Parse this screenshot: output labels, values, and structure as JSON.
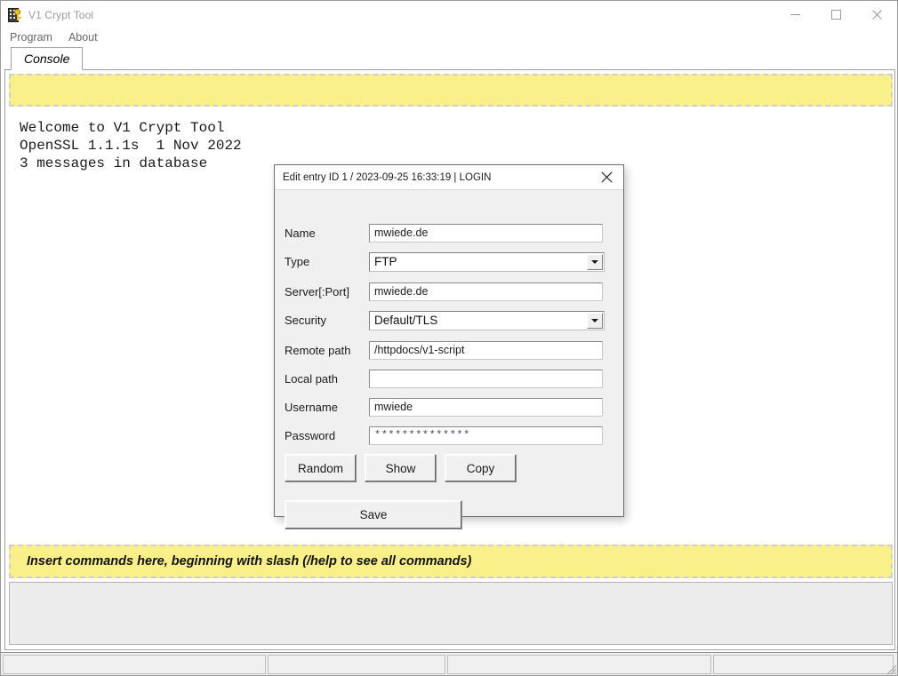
{
  "window": {
    "title": "V1 Crypt Tool",
    "icon": "app-building-key-icon",
    "controls": {
      "minimize": "minimize-icon",
      "maximize": "maximize-icon",
      "close": "close-icon"
    }
  },
  "menubar": {
    "items": [
      {
        "label": "Program"
      },
      {
        "label": "About"
      }
    ]
  },
  "tabs": [
    {
      "label": "Console",
      "active": true
    }
  ],
  "console": {
    "header_value": "",
    "header_placeholder": "",
    "output": "Welcome to V1 Crypt Tool\nOpenSSL 1.1.1s  1 Nov 2022\n3 messages in database",
    "output_lines": [
      "Welcome to V1 Crypt Tool",
      "OpenSSL 1.1.1s  1 Nov 2022",
      "3 messages in database"
    ],
    "command_hint": "Insert commands here, beginning with slash (/help to see all commands)",
    "command_value": ""
  },
  "dialog": {
    "title": "Edit entry ID 1 / 2023-09-25 16:33:19 | LOGIN",
    "close_icon": "close-icon",
    "fields": [
      {
        "label": "Name",
        "value": "mwiede.de",
        "kind": "text"
      },
      {
        "label": "Type",
        "value": "FTP",
        "kind": "combo"
      },
      {
        "label": "Server[:Port]",
        "value": "mwiede.de",
        "kind": "text"
      },
      {
        "label": "Security",
        "value": "Default/TLS",
        "kind": "combo"
      },
      {
        "label": "Remote path",
        "value": "/httpdocs/v1-script",
        "kind": "text"
      },
      {
        "label": "Local path",
        "value": "",
        "kind": "text"
      },
      {
        "label": "Username",
        "value": "mwiede",
        "kind": "text"
      },
      {
        "label": "Password",
        "value": "**************",
        "kind": "password"
      }
    ],
    "buttons": {
      "random": "Random",
      "show": "Show",
      "copy": "Copy",
      "save": "Save"
    }
  },
  "statusbar": {
    "panels": [
      "",
      "",
      "",
      ""
    ],
    "grip": "resize-grip-icon"
  },
  "colors": {
    "yellow": "#faf08a",
    "window_bg": "#ffffff",
    "dialog_bg": "#f0f0f0",
    "title_text": "#9a9a9a"
  }
}
